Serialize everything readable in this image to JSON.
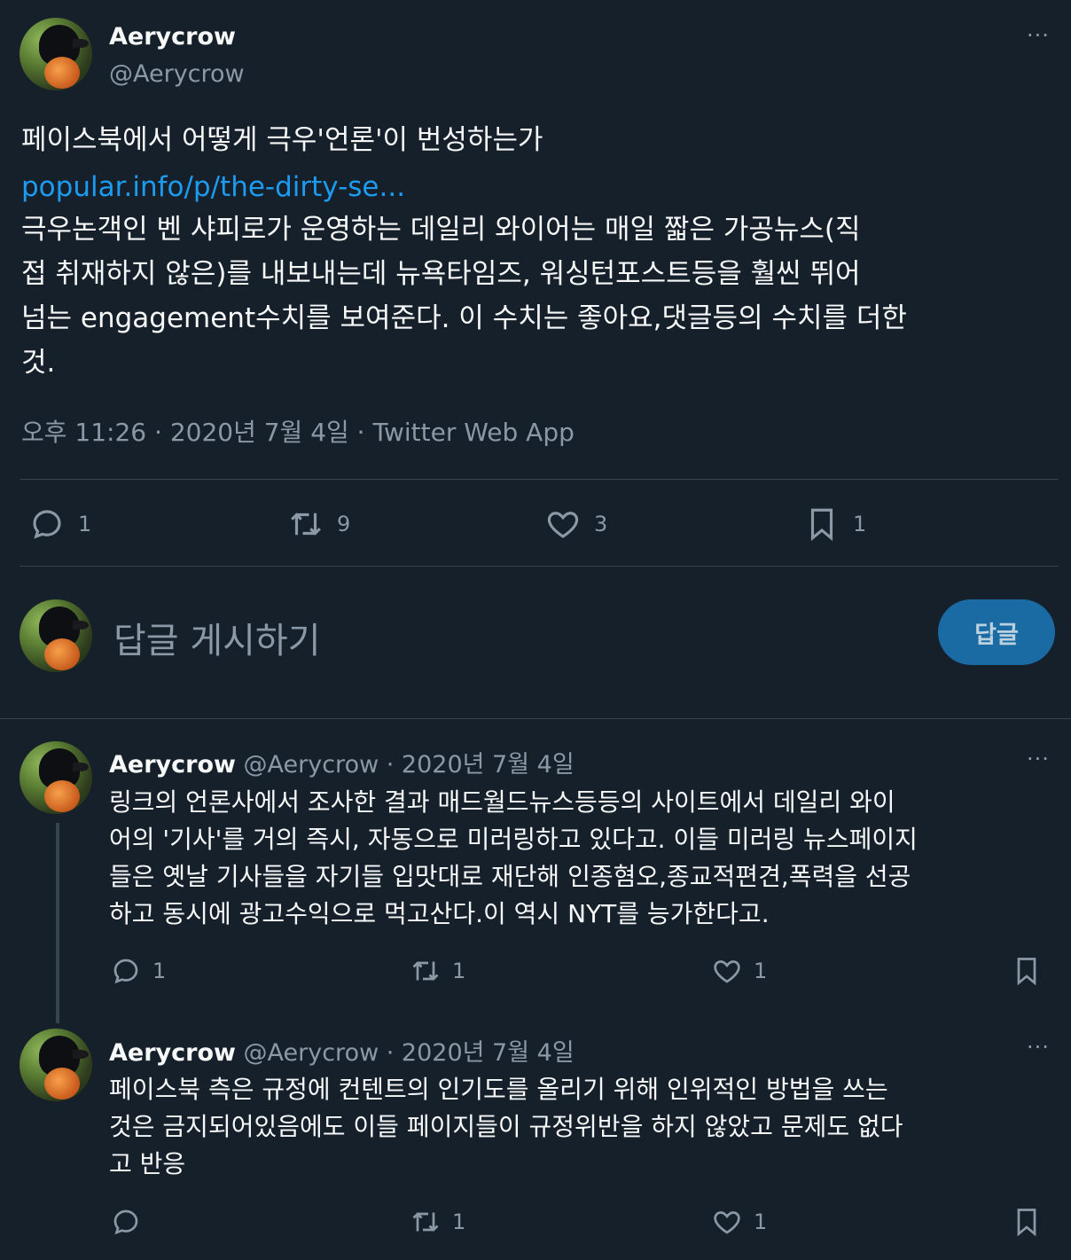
{
  "main_tweet": {
    "name": "Aerycrow",
    "handle": "@Aerycrow",
    "more": "···",
    "title_line": "페이스북에서 어떻게 극우'언론'이 번성하는가",
    "link": "popular.info/p/the-dirty-se...",
    "body_lines": [
      "극우논객인 벤 샤피로가 운영하는 데일리 와이어는 매일 짧은 가공뉴스(직",
      "접 취재하지 않은)를 내보내는데 뉴욕타임즈, 워싱턴포스트등을 훨씬 뛰어",
      "넘는 engagement수치를 보여준다. 이 수치는 좋아요,댓글등의 수치를 더한",
      "것."
    ],
    "meta": "오후 11:26 · 2020년 7월 4일 · Twitter Web App",
    "actions": {
      "reply": "1",
      "retweet": "9",
      "like": "3",
      "bookmark": "1"
    }
  },
  "reply_box": {
    "placeholder": "답글 게시하기",
    "button": "답글"
  },
  "replies": [
    {
      "name": "Aerycrow",
      "handle_date": "@Aerycrow · 2020년 7월 4일",
      "more": "···",
      "lines": [
        "링크의 언론사에서 조사한 결과 매드월드뉴스등등의 사이트에서 데일리 와이",
        "어의 '기사'를 거의 즉시, 자동으로 미러링하고 있다고. 이들 미러링 뉴스페이지",
        "들은 옛날 기사들을 자기들 입맛대로 재단해 인종혐오,종교적편견,폭력을 선공",
        "하고 동시에 광고수익으로 먹고산다.이 역시 NYT를 능가한다고."
      ],
      "actions": {
        "reply": "1",
        "retweet": "1",
        "like": "1"
      }
    },
    {
      "name": "Aerycrow",
      "handle_date": "@Aerycrow · 2020년 7월 4일",
      "more": "···",
      "lines": [
        "페이스북 측은 규정에 컨텐트의 인기도를 올리기 위해 인위적인 방법을 쓰는",
        "것은 금지되어있음에도 이들 페이지들이 규정위반을 하지 않았고 문제도 없다",
        "고 반응"
      ],
      "actions": {
        "reply": "",
        "retweet": "1",
        "like": "1"
      }
    }
  ],
  "colors": {
    "background": "#15202b",
    "text": "#f7f9f9",
    "muted": "#8b98a5",
    "link": "#1d9bf0",
    "divider": "#38444d"
  }
}
